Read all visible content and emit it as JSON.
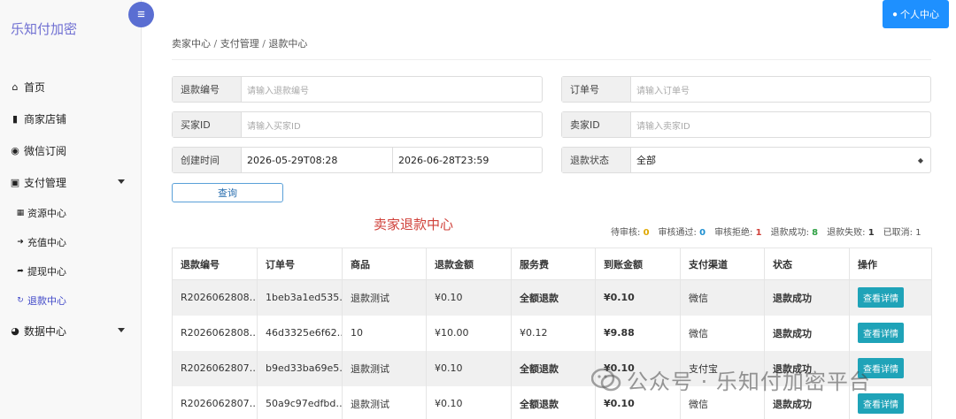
{
  "sidebar": {
    "brand": "乐知付加密",
    "toggle_icon": "menu-icon",
    "items": [
      {
        "label": "首页",
        "icon": "home-icon",
        "glyph": "⌂"
      },
      {
        "label": "商家店铺",
        "icon": "briefcase-icon",
        "glyph": "▮"
      },
      {
        "label": "微信订阅",
        "icon": "wechat-icon",
        "glyph": "◉"
      },
      {
        "label": "支付管理",
        "icon": "payment-icon",
        "glyph": "▣"
      }
    ],
    "sub_items": [
      {
        "label": "资源中心",
        "icon": "resource-icon",
        "glyph": "▦"
      },
      {
        "label": "充值中心",
        "icon": "sign-in-icon",
        "glyph": "➜"
      },
      {
        "label": "提现中心",
        "icon": "sign-out-icon",
        "glyph": "➦"
      },
      {
        "label": "退款中心",
        "icon": "refresh-icon",
        "glyph": "↻"
      }
    ],
    "data_center": {
      "label": "数据中心",
      "icon": "pie-chart-icon",
      "glyph": "◕"
    }
  },
  "topbar": {
    "user_button": "个人中心",
    "user_icon": "user-circle-icon"
  },
  "breadcrumb": [
    "卖家中心",
    "支付管理",
    "退款中心"
  ],
  "filters": {
    "refund_no": {
      "label": "退款编号",
      "placeholder": "请输入退款编号"
    },
    "order_no": {
      "label": "订单号",
      "placeholder": "请输入订单号"
    },
    "buyer_id": {
      "label": "买家ID",
      "placeholder": "请输入买家ID"
    },
    "seller_id": {
      "label": "卖家ID",
      "placeholder": "请输入卖家ID"
    },
    "created_time": {
      "label": "创建时间",
      "start": "2026-05-29T08:28",
      "end": "2026-06-28T23:59"
    },
    "refund_status": {
      "label": "退款状态",
      "value": "全部"
    },
    "query_button": "查询"
  },
  "center_title": "卖家退款中心",
  "stats": [
    {
      "label": "待审核: ",
      "value": "0",
      "color": "#e0a800"
    },
    {
      "label": "审核通过: ",
      "value": "0",
      "color": "#1e8fd0"
    },
    {
      "label": "审核拒绝: ",
      "value": "1",
      "color": "#d0413a"
    },
    {
      "label": "退款成功: ",
      "value": "8",
      "color": "#2ea043"
    },
    {
      "label": "退款失败: ",
      "value": "1",
      "color": "#333333"
    },
    {
      "label": "已取消: ",
      "value": "1",
      "color": "#555555"
    }
  ],
  "table": {
    "columns": [
      "退款编号",
      "订单号",
      "商品",
      "退款金额",
      "服务费",
      "到账金额",
      "支付渠道",
      "状态",
      "操作"
    ],
    "rows": [
      {
        "refund_no": "R2026062808…",
        "order_no": "1beb3a1ed535…",
        "product": "退款测试",
        "amount": "¥0.10",
        "fee": "全额退款",
        "received": "¥0.10",
        "channel": "微信",
        "status": "退款成功",
        "action": "查看详情"
      },
      {
        "refund_no": "R2026062808…",
        "order_no": "46d3325e6f62…",
        "product": "10",
        "amount": "¥10.00",
        "fee": "¥0.12",
        "received": "¥9.88",
        "channel": "微信",
        "status": "退款成功",
        "action": "查看详情"
      },
      {
        "refund_no": "R2026062807…",
        "order_no": "b9ed33ba69e5…",
        "product": "退款测试",
        "amount": "¥0.10",
        "fee": "全额退款",
        "received": "¥0.10",
        "channel": "支付宝",
        "status": "退款成功",
        "action": "查看详情"
      },
      {
        "refund_no": "R2026062807…",
        "order_no": "50a9c97edfbd…",
        "product": "退款测试",
        "amount": "¥0.10",
        "fee": "全额退款",
        "received": "¥0.10",
        "channel": "微信",
        "status": "退款成功",
        "action": "查看详情"
      }
    ]
  },
  "watermark": "公众号 · 乐知付加密平台"
}
